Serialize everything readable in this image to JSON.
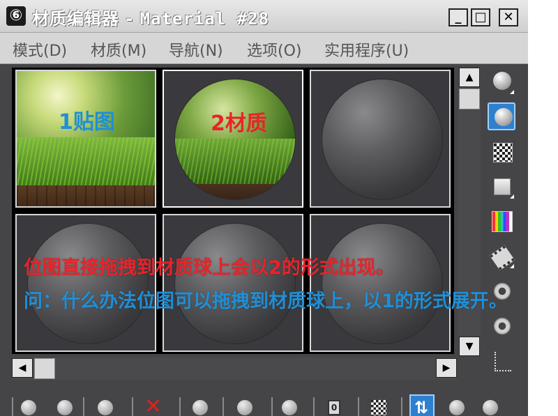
{
  "window": {
    "title_prefix": "材质编辑器 - ",
    "title_material": "Material #28",
    "title_icon": "⑥",
    "controls": {
      "minimize": "_",
      "maximize": "□",
      "close": "✕"
    }
  },
  "menu": {
    "items": [
      {
        "label": "模式(D)"
      },
      {
        "label": "材质(M)"
      },
      {
        "label": "导航(N)"
      },
      {
        "label": "选项(O)"
      },
      {
        "label": "实用程序(U)"
      }
    ]
  },
  "slots": {
    "slot1_label": "1贴图",
    "slot2_label": "2材质"
  },
  "annotations": {
    "line1": "位图直接拖拽到材质球上会以2的形式出现。",
    "line2": "问：什么办法位图可以拖拽到材质球上，以1的形式展开。",
    "line1_color": "#e8232a",
    "line2_color": "#1f8fd6"
  },
  "label_colors": {
    "slot1": "#1f8fd6",
    "slot2": "#e8232a"
  },
  "scrollbars": {
    "up_arrow": "▲",
    "down_arrow": "▼",
    "left_arrow": "◀",
    "right_arrow": "▶"
  },
  "bottom_toolbar": {
    "reset_box_label": "0",
    "active_arrows": "⇅"
  }
}
